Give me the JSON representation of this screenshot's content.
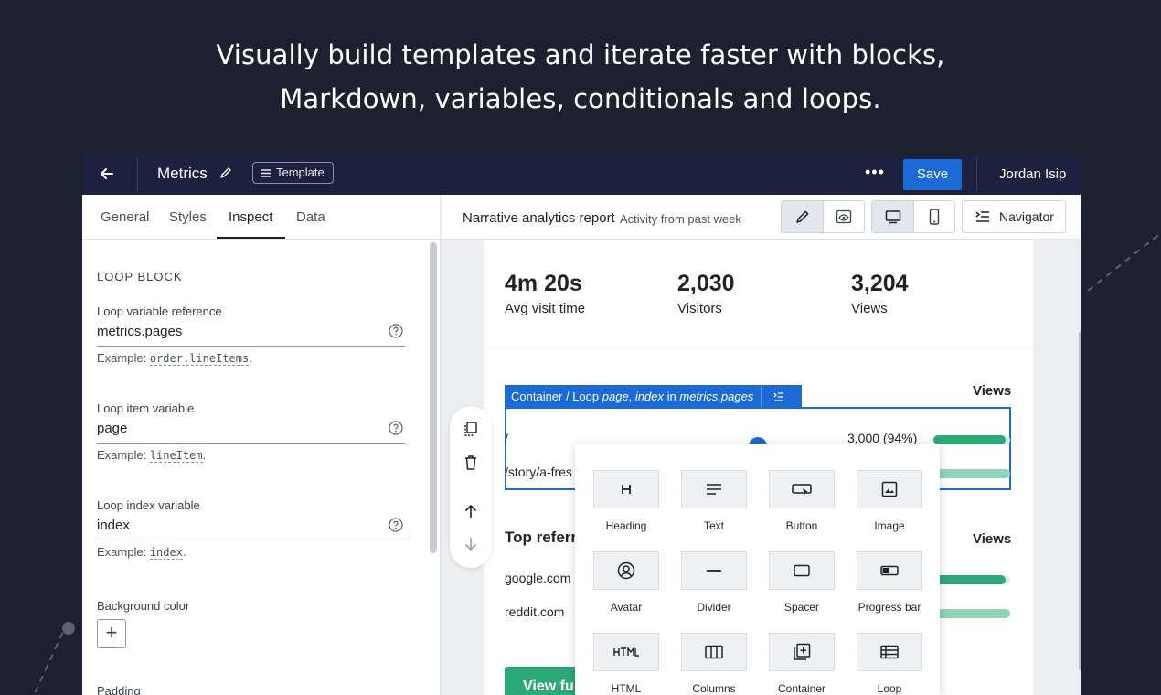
{
  "hero": {
    "line1": "Visually build templates and iterate faster with blocks,",
    "line2": "Markdown, variables, conditionals and loops."
  },
  "topbar": {
    "doc_title": "Metrics",
    "badge": "Template",
    "more": "•••",
    "save": "Save",
    "user": "Jordan Isip"
  },
  "left_tabs": [
    "General",
    "Styles",
    "Inspect",
    "Data"
  ],
  "inspect": {
    "section": "LOOP BLOCK",
    "fields": [
      {
        "label": "Loop variable reference",
        "value": "metrics.pages",
        "example_prefix": "Example:",
        "example_code": "order.lineItems",
        "example_suffix": "."
      },
      {
        "label": "Loop item variable",
        "value": "page",
        "example_prefix": "Example:",
        "example_code": "lineItem",
        "example_suffix": "."
      },
      {
        "label": "Loop index variable",
        "value": "index",
        "example_prefix": "Example:",
        "example_code": "index",
        "example_suffix": "."
      }
    ],
    "bg_label": "Background color",
    "bg_add": "+",
    "padding_label": "Padding"
  },
  "preview": {
    "title": "Narrative analytics report",
    "subtitle": "Activity from past week",
    "navigator": "Navigator"
  },
  "doc": {
    "stats": [
      {
        "value": "4m 20s",
        "label": "Avg visit time"
      },
      {
        "value": "2,030",
        "label": "Visitors"
      },
      {
        "value": "3,204",
        "label": "Views"
      }
    ],
    "views_header": "Views",
    "loop_tag": {
      "prefix": "Container / Loop",
      "item": "page",
      "sep": ",",
      "index": "index",
      "in": "in",
      "ref": "metrics.pages"
    },
    "page_rows": [
      {
        "path": "/",
        "value": "3,000 (94%)",
        "fraction": 0.94
      },
      {
        "path": "/story/a-fres",
        "value": "",
        "fraction": 1.0
      }
    ],
    "referrers_title": "Top referr",
    "referrer_rows": [
      {
        "name": "google.com",
        "fraction": 0.94
      },
      {
        "name": "reddit.com",
        "fraction": 1.0
      }
    ],
    "cta": "View fu"
  },
  "blocks": [
    "Heading",
    "Text",
    "Button",
    "Image",
    "Avatar",
    "Divider",
    "Spacer",
    "Progress bar",
    "HTML",
    "Columns",
    "Container",
    "Loop"
  ],
  "colors": {
    "accent": "#1b6ad6",
    "bar_primary": "#2da877",
    "bar_secondary": "#8fd4b6",
    "topbar": "#1c2140",
    "backdrop": "#1c2130"
  }
}
